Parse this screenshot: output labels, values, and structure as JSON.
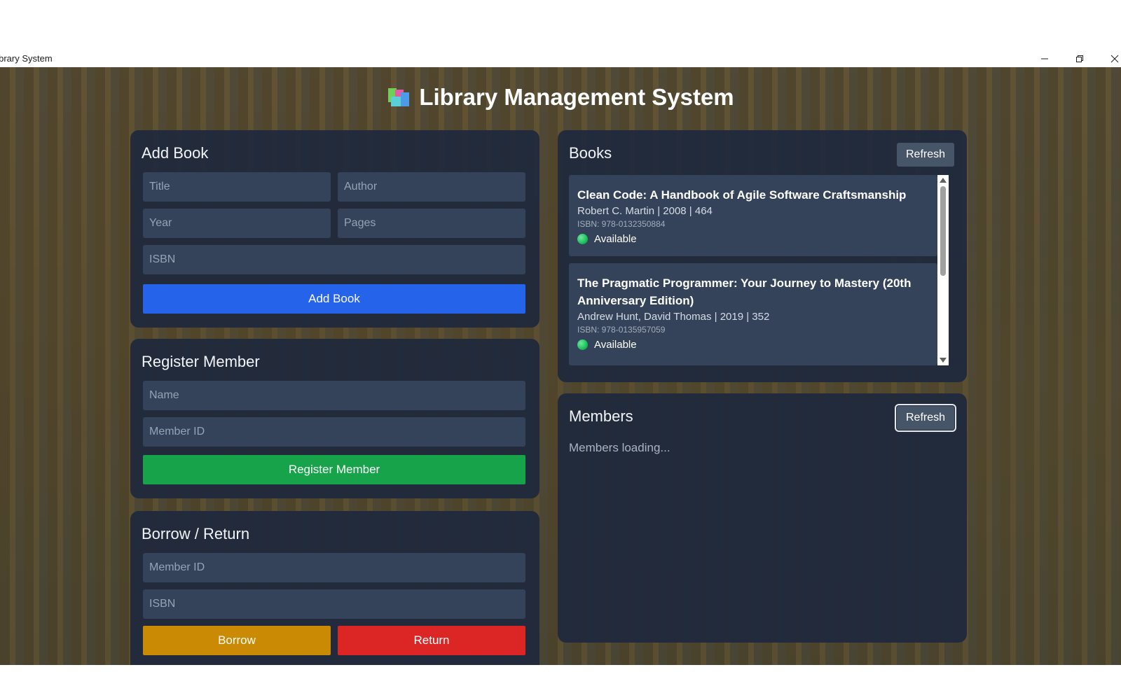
{
  "window": {
    "title": "Library System"
  },
  "header": {
    "title": "Library Management System",
    "icon": "books-icon"
  },
  "add_book": {
    "heading": "Add Book",
    "title_placeholder": "Title",
    "author_placeholder": "Author",
    "year_placeholder": "Year",
    "pages_placeholder": "Pages",
    "isbn_placeholder": "ISBN",
    "submit_label": "Add Book"
  },
  "register_member": {
    "heading": "Register Member",
    "name_placeholder": "Name",
    "member_id_placeholder": "Member ID",
    "submit_label": "Register Member"
  },
  "borrow_return": {
    "heading": "Borrow / Return",
    "member_id_placeholder": "Member ID",
    "isbn_placeholder": "ISBN",
    "borrow_label": "Borrow",
    "return_label": "Return"
  },
  "books": {
    "heading": "Books",
    "refresh_label": "Refresh",
    "items": [
      {
        "title": "Clean Code: A Handbook of Agile Software Craftsmanship",
        "meta": "Robert C. Martin | 2008 | 464",
        "isbn": "ISBN: 978-0132350884",
        "status": "Available"
      },
      {
        "title": "The Pragmatic Programmer: Your Journey to Mastery (20th Anniversary Edition)",
        "meta": "Andrew Hunt, David Thomas | 2019 | 352",
        "isbn": "ISBN: 978-0135957059",
        "status": "Available"
      }
    ]
  },
  "members": {
    "heading": "Members",
    "refresh_label": "Refresh",
    "loading_text": "Members loading..."
  },
  "colors": {
    "add_button": "#2563eb",
    "register_button": "#16a34a",
    "borrow_button": "#ca8a04",
    "return_button": "#dc2626",
    "available_status": "#22c55e"
  }
}
